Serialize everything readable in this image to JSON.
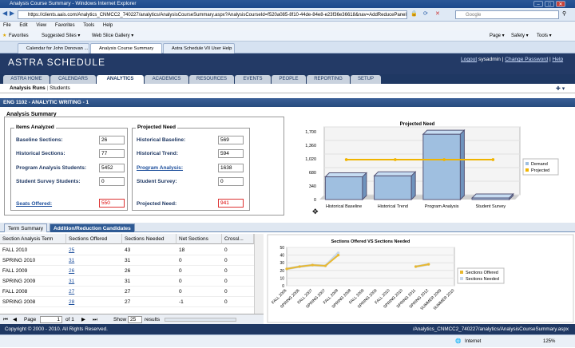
{
  "browser": {
    "window_title": "Analysis Course Summary - Windows Internet Explorer",
    "address": "https://clients.aais.com/Analytics_CNMCC2_740227/analytics/AnalysisCourseSummary.aspx?AnalysisCourseId=f520a085-8f10-44de-84e8-e23f36e36618&nav=AddReducePanel",
    "search_placeholder": "Google",
    "menu": [
      "File",
      "Edit",
      "View",
      "Favorites",
      "Tools",
      "Help"
    ],
    "favorites_label": "Favorites",
    "suggested_sites": "Suggested Sites ▾",
    "web_slice": "Web Slice Gallery ▾",
    "tabs": [
      "Calendar for John Donovan ...",
      "Analysis Course Summary",
      "Astra Schedule VII User Help"
    ],
    "cmd": {
      "page": "Page ▾",
      "safety": "Safety ▾",
      "tools": "Tools ▾"
    },
    "status_zone": "Internet",
    "zoom": "125%"
  },
  "app": {
    "logo": "ASTRA SCHEDULE",
    "logout": "Logout",
    "user": "sysadmin",
    "change_password": "Change Password",
    "help": "Help",
    "nav_tabs": [
      "ASTRA HOME",
      "CALENDARS",
      "ANALYTICS",
      "ACADEMICS",
      "RESOURCES",
      "EVENTS",
      "PEOPLE",
      "REPORTING",
      "SETUP"
    ],
    "active_nav": "ANALYTICS",
    "subnav_active": "Analysis Runs",
    "subnav_other": "Students",
    "course_title": "ENG 1102 - ANALYTIC WRITING - 1"
  },
  "summary": {
    "title": "Analysis Summary",
    "items_analyzed": "Items Analyzed",
    "projected_need_title": "Projected Need",
    "baseline_label": "Baseline Sections:",
    "baseline": "26",
    "historical_label": "Historical Sections:",
    "historical": "77",
    "program_label": "Program Analysis Students:",
    "program": "5452",
    "survey_label": "Student Survey Students:",
    "survey": "0",
    "seats_label": "Seats Offered:",
    "seats": "550",
    "hist_baseline_label": "Historical Baseline:",
    "hist_baseline": "569",
    "hist_trend_label": "Historical Trend:",
    "hist_trend": "594",
    "prog_analysis_label": "Program Analysis:",
    "prog_analysis": "1638",
    "stud_survey_label": "Student Survey:",
    "stud_survey": "0",
    "projected_label": "Projected Need:",
    "projected": "941"
  },
  "grid": {
    "tabs": [
      "Term Summary",
      "Addition/Reduction Candidates"
    ],
    "columns": [
      "Section Analysis Term",
      "Sections Offered",
      "Sections Needed",
      "Net Sections",
      "Crossl..."
    ],
    "rows": [
      {
        "term": "FALL 2010",
        "offered": "25",
        "needed": "43",
        "net": "18",
        "cross": "0"
      },
      {
        "term": "SPRING 2010",
        "offered": "31",
        "needed": "31",
        "net": "0",
        "cross": "0"
      },
      {
        "term": "FALL 2009",
        "offered": "26",
        "needed": "26",
        "net": "0",
        "cross": "0"
      },
      {
        "term": "SPRING 2009",
        "offered": "31",
        "needed": "31",
        "net": "0",
        "cross": "0"
      },
      {
        "term": "FALL 2008",
        "offered": "27",
        "needed": "27",
        "net": "0",
        "cross": "0"
      },
      {
        "term": "SPRING 2008",
        "offered": "28",
        "needed": "27",
        "net": "-1",
        "cross": "0"
      }
    ],
    "pager": {
      "page_label": "Page",
      "page": "1",
      "of": "of 1",
      "show": "Show",
      "size": "25",
      "results": "results"
    }
  },
  "footer": {
    "copyright": "Copyright © 2000 - 2010.  All Rights Reserved.",
    "path": "/Analytics_CNMCC2_740227/analytics/AnalysisCourseSummary.aspx"
  },
  "chart_data": [
    {
      "type": "bar",
      "title": "Projected Need",
      "categories": [
        "Historical Baseline",
        "Historical Trend",
        "Program Analysis",
        "Student Survey"
      ],
      "series": [
        {
          "name": "Demand",
          "values": [
            569,
            594,
            1638,
            0
          ]
        },
        {
          "name": "Projected",
          "type": "line",
          "values": [
            941,
            941,
            941,
            941
          ]
        }
      ],
      "ylim": [
        0,
        1700
      ],
      "yticks": [
        "0",
        "340",
        "680",
        "1,020",
        "1,360",
        "1,700"
      ],
      "legend": "right",
      "colors": {
        "Demand": "#8fb3d9",
        "Projected": "#f0b400"
      }
    },
    {
      "type": "line",
      "title": "Sections Offered VS Sections Needed",
      "categories": [
        "FALL 2006",
        "SPRING 2006",
        "FALL 2007",
        "SPRING 2007",
        "FALL 2008",
        "SPRING 2008",
        "FALL 2009",
        "SPRING 2009",
        "FALL 2010",
        "SPRING 2010",
        "SPRING 2011",
        "SPRING 2012",
        "SUMMER 2009",
        "SUMMER 2010"
      ],
      "series": [
        {
          "name": "Sections Offered",
          "values": [
            22,
            25,
            27,
            26,
            40,
            null,
            null,
            null,
            null,
            null,
            25,
            28,
            null,
            null
          ]
        },
        {
          "name": "Sections Needed",
          "values": [
            22,
            25,
            27,
            26,
            43,
            null,
            null,
            null,
            null,
            null,
            25,
            28,
            null,
            null
          ]
        }
      ],
      "ylim": [
        0,
        50
      ],
      "yticks": [
        "0",
        "10",
        "20",
        "30",
        "40",
        "50"
      ],
      "legend": "right",
      "colors": {
        "Sections Offered": "#e8b830",
        "Sections Needed": "#c8d7ea"
      }
    }
  ]
}
